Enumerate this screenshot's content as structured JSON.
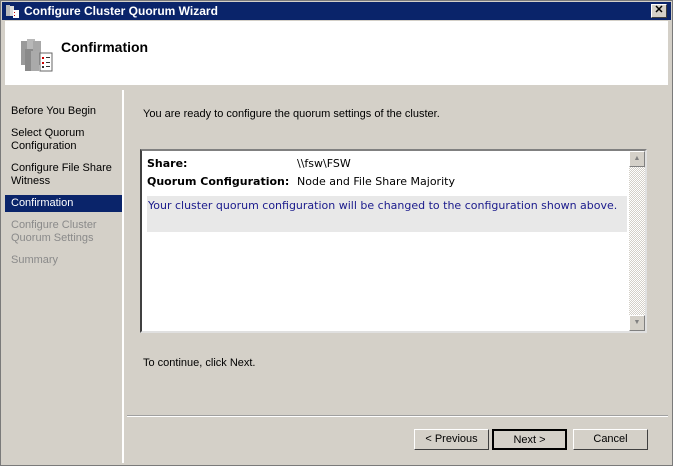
{
  "window": {
    "title": "Configure Cluster Quorum Wizard",
    "close_label": "✕"
  },
  "header": {
    "title": "Confirmation"
  },
  "sidebar": {
    "items": [
      {
        "label": "Before You Begin",
        "state": "normal"
      },
      {
        "label": "Select Quorum Configuration",
        "state": "normal"
      },
      {
        "label": "Configure File Share Witness",
        "state": "normal"
      },
      {
        "label": "Confirmation",
        "state": "active"
      },
      {
        "label": "Configure Cluster Quorum Settings",
        "state": "disabled"
      },
      {
        "label": "Summary",
        "state": "disabled"
      }
    ]
  },
  "main": {
    "intro": "You are ready to configure the quorum settings of the cluster.",
    "share_label": "Share:",
    "share_value": "\\\\fsw\\FSW",
    "quorum_label": "Quorum Configuration:",
    "quorum_value": "Node and File Share Majority",
    "note": "Your cluster quorum configuration will be changed to the configuration shown above.",
    "continue": "To continue, click Next."
  },
  "buttons": {
    "previous": "< Previous",
    "next": "Next >",
    "cancel": "Cancel"
  }
}
